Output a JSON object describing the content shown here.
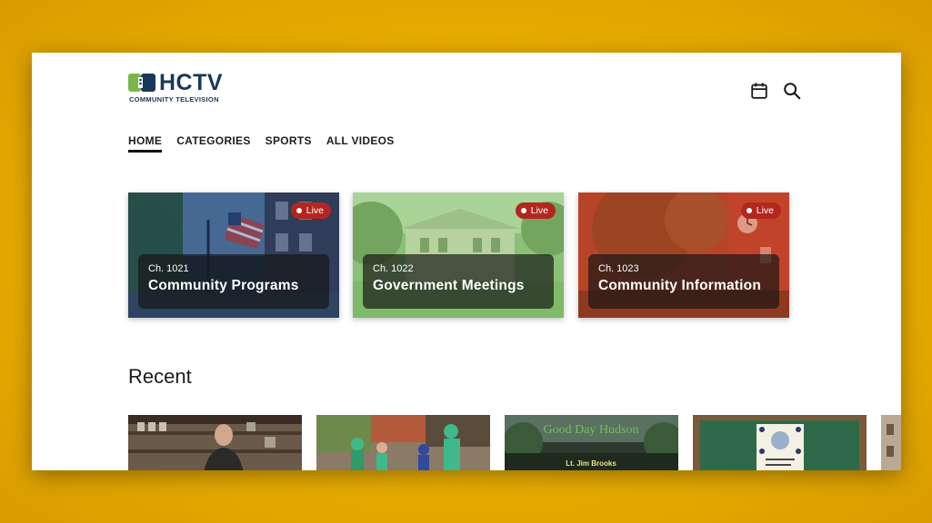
{
  "header": {
    "logo_text": "HCTV",
    "logo_subtitle": "COMMUNITY TELEVISION",
    "calendar_icon": "calendar-icon",
    "search_icon": "search-icon"
  },
  "nav": {
    "items": [
      {
        "label": "HOME",
        "active": true
      },
      {
        "label": "CATEGORIES",
        "active": false
      },
      {
        "label": "SPORTS",
        "active": false
      },
      {
        "label": "ALL VIDEOS",
        "active": false
      }
    ]
  },
  "channels": [
    {
      "channel": "Ch. 1021",
      "title": "Community Programs",
      "badge": "Live",
      "tint": "#1b3a66"
    },
    {
      "channel": "Ch. 1022",
      "title": "Government Meetings",
      "badge": "Live",
      "tint": "#7fbf6a"
    },
    {
      "channel": "Ch. 1023",
      "title": "Community Information",
      "badge": "Live",
      "tint": "#c0391f"
    }
  ],
  "recent": {
    "heading": "Recent",
    "items": [
      {
        "thumbnail": "interview-in-workshop"
      },
      {
        "thumbnail": "parade-costumes"
      },
      {
        "thumbnail": "good-day-hudson",
        "title_text": "Good Day Hudson",
        "caption": "Lt. Jim Brooks"
      },
      {
        "thumbnail": "chalkboard-notice"
      }
    ]
  },
  "colors": {
    "background": "#e8ad00",
    "brand": "#17385a",
    "live_badge": "#b3261e"
  }
}
